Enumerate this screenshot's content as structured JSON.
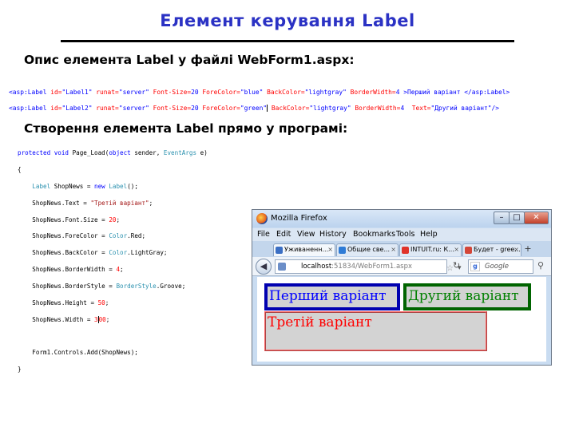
{
  "slide": {
    "title": "Елемент керування Label",
    "section1_heading": "Опис елемента Label у файлі WebForm1.aspx:",
    "section2_heading": "Створення елемента Label прямо у програмі:"
  },
  "aspx_code": {
    "line1": {
      "open": "<asp:Label",
      "id_attr": " id=",
      "id_val": "\"Label1\"",
      "runat_attr": " runat=",
      "runat_val": "\"server\"",
      "fs_attr": " Font-Size=",
      "fs_val": "20",
      "fc_attr": " ForeColor=",
      "fc_val": "\"blue\"",
      "bc_attr": " BackColor=",
      "bc_val": "\"lightgray\"",
      "bw_attr": " BorderWidth=",
      "bw_val": "4",
      "content": " >Перший варіант </asp:Label>"
    },
    "line2": {
      "open": "<asp:Label",
      "id_attr": " id=",
      "id_val": "\"Label2\"",
      "runat_attr": " runat=",
      "runat_val": "\"server\"",
      "fs_attr": " Font-Size=",
      "fs_val": "20",
      "fc_attr": " ForeColor=",
      "fc_val": "\"green\"",
      "bc_attr": " BackColor=",
      "bc_val": "\"lightgray\"",
      "bw_attr": " BorderWidth=",
      "bw_val": "4",
      "text_attr": "  Text=",
      "text_val": "\"Другий варіант\"",
      "close": "/>"
    }
  },
  "cs_code": {
    "l1_kw": "protected void",
    "l1_rest": " Page_Load(",
    "l1_kw2": "object",
    "l1_rest2": " sender, ",
    "l1_type": "EventArgs",
    "l1_rest3": " e)",
    "l2": "{",
    "l3_type": "Label",
    "l3_rest": " ShopNews = ",
    "l3_kw": "new",
    "l3_type2": " Label",
    "l3_end": "();",
    "l4_start": "ShopNews.Text = ",
    "l4_str": "\"Третій варіант\"",
    "l4_end": ";",
    "l5_start": "ShopNews.Font.Size = ",
    "l5_num": "20",
    "l5_end": ";",
    "l6_start": "ShopNews.ForeColor = ",
    "l6_type": "Color",
    "l6_end": ".Red;",
    "l7_start": "ShopNews.BackColor = ",
    "l7_type": "Color",
    "l7_end": ".LightGray;",
    "l8_start": "ShopNews.BorderWidth = ",
    "l8_num": "4",
    "l8_end": ";",
    "l9_start": "ShopNews.BorderStyle = ",
    "l9_type": "BorderStyle",
    "l9_end": ".Groove;",
    "l10_start": "ShopNews.Height = ",
    "l10_num": "50",
    "l10_end": ";",
    "l11_start": "ShopNews.Width = ",
    "l11_num_a": "3",
    "l11_num_b": "00",
    "l11_end": ";",
    "l12_start": "Form1.Controls.Add(ShopNews);",
    "l13": "}"
  },
  "browser": {
    "window_title": "Mozilla Firefox",
    "menu": [
      "File",
      "Edit",
      "View",
      "History",
      "Bookmarks",
      "Tools",
      "Help"
    ],
    "tabs": [
      "Уживаненн...",
      "Общие све...",
      "INTUIT.ru: К...",
      "Будет - gree..."
    ],
    "new_tab": "+",
    "url_host": "localhost",
    "url_path": ":51834/WebForm1.aspx",
    "search_placeholder": "Google",
    "labels": {
      "label1": "Перший варіант",
      "label2": "Другий варіант",
      "label3": "Третій варіант"
    }
  },
  "colors": {
    "title": "#2b32c4",
    "label1_text": "#0000ff",
    "label2_text": "#008000",
    "label3_text": "#ff0000",
    "label_bg": "#d3d3d3"
  }
}
